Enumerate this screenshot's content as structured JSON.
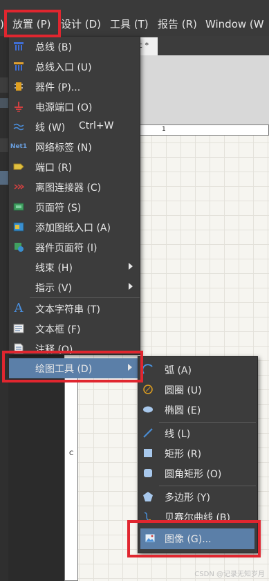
{
  "menubar": {
    "items": [
      {
        "label": ")"
      },
      {
        "label": "放置 (P)"
      },
      {
        "label": "设计 (D)"
      },
      {
        "label": "工具 (T)"
      },
      {
        "label": "报告 (R)"
      },
      {
        "label": "Window (W"
      }
    ]
  },
  "document": {
    "tab_label": "c *",
    "ruler_top_label": "1",
    "ruler_left_label": "C"
  },
  "place_menu": {
    "items": [
      {
        "label": "总线 (B)",
        "icon": "bus-icon"
      },
      {
        "label": "总线入口 (U)",
        "icon": "bus-entry-icon"
      },
      {
        "label": "器件 (P)...",
        "icon": "part-icon"
      },
      {
        "label": "电源端口 (O)",
        "icon": "power-port-icon"
      },
      {
        "label": "线 (W)",
        "shortcut": "Ctrl+W",
        "icon": "wire-icon"
      },
      {
        "label": "网络标签 (N)",
        "icon": "net-label-icon",
        "icon_text": "Net1"
      },
      {
        "label": "端口 (R)",
        "icon": "port-icon"
      },
      {
        "label": "离图连接器 (C)",
        "icon": "off-sheet-connector-icon"
      },
      {
        "label": "页面符 (S)",
        "icon": "sheet-symbol-icon"
      },
      {
        "label": "添加图纸入口 (A)",
        "icon": "sheet-entry-icon"
      },
      {
        "label": "器件页面符 (I)",
        "icon": "device-sheet-symbol-icon"
      },
      {
        "label": "线束 (H)",
        "has_submenu": true
      },
      {
        "label": "指示 (V)",
        "has_submenu": true
      },
      {
        "label": "文本字符串 (T)",
        "icon": "text-string-icon",
        "icon_text": "A"
      },
      {
        "label": "文本框 (F)",
        "icon": "text-frame-icon"
      },
      {
        "label": "注释 (O)",
        "icon": "note-icon"
      },
      {
        "label": "绘图工具 (D)",
        "has_submenu": true,
        "selected": true
      }
    ]
  },
  "drawing_tools_menu": {
    "items": [
      {
        "label": "弧 (A)",
        "icon": "arc-icon"
      },
      {
        "label": "圆圈 (U)",
        "icon": "circle-icon"
      },
      {
        "label": "椭圆 (E)",
        "icon": "ellipse-icon"
      },
      {
        "label": "线 (L)",
        "icon": "line-icon"
      },
      {
        "label": "矩形 (R)",
        "icon": "rectangle-icon"
      },
      {
        "label": "圆角矩形 (O)",
        "icon": "round-rectangle-icon"
      },
      {
        "label": "多边形 (Y)",
        "icon": "polygon-icon"
      },
      {
        "label": "贝赛尔曲线 (B)",
        "icon": "bezier-icon"
      },
      {
        "label": "图像 (G)...",
        "icon": "image-icon",
        "selected": true
      }
    ]
  },
  "watermark": "CSDN @记录无知岁月",
  "colors": {
    "menu_bg": "#3c3c3c",
    "highlight": "#5b7fa8",
    "annotation_red": "#e0262f"
  }
}
